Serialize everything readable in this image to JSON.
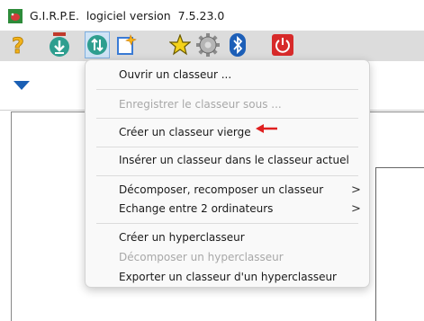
{
  "window": {
    "app_name": "G.I.R.P.E.",
    "version_text": "logiciel version  7.5.23.0"
  },
  "toolbar": {
    "buttons": [
      {
        "name": "help",
        "icon": "question-mark-icon",
        "color": "#f2b21a"
      },
      {
        "name": "download",
        "icon": "download-icon",
        "color": "#2e9e8f"
      },
      {
        "name": "sort",
        "icon": "sort-arrows-icon",
        "color": "#2e9e8f"
      },
      {
        "name": "new-file",
        "icon": "new-document-icon",
        "color": "#3a7bd5"
      },
      {
        "name": "star",
        "icon": "star-icon",
        "color": "#f4d21a"
      },
      {
        "name": "settings",
        "icon": "gear-icon",
        "color": "#8a8a8a"
      },
      {
        "name": "bluetooth",
        "icon": "bluetooth-icon",
        "color": "#1d5fb8"
      },
      {
        "name": "power",
        "icon": "power-icon",
        "color": "#d72a2a"
      }
    ]
  },
  "menu": {
    "items": [
      {
        "label": "Ouvrir un classeur ...",
        "enabled": true,
        "submenu": false
      },
      {
        "label": "Enregistrer le classeur sous ...",
        "enabled": false,
        "submenu": false
      },
      {
        "label": "Créer un classeur vierge",
        "enabled": true,
        "submenu": false,
        "highlighted_by_arrow": true
      },
      {
        "label": "Insérer un classeur dans le classeur actuel",
        "enabled": true,
        "submenu": false
      },
      {
        "label": "Décomposer, recomposer un classeur",
        "enabled": true,
        "submenu": true
      },
      {
        "label": "Echange entre 2 ordinateurs",
        "enabled": true,
        "submenu": true
      },
      {
        "label": "Créer un hyperclasseur",
        "enabled": true,
        "submenu": false
      },
      {
        "label": "Décomposer un hyperclasseur",
        "enabled": false,
        "submenu": false
      },
      {
        "label": "Exporter un classeur d'un hyperclasseur",
        "enabled": true,
        "submenu": false
      }
    ],
    "submenu_glyph": ">"
  },
  "colors": {
    "toolbar_bg": "#dcdcdc",
    "menu_bg": "#f9f9f9",
    "disabled_text": "#a8a8a8",
    "annotation_arrow": "#e02020"
  }
}
